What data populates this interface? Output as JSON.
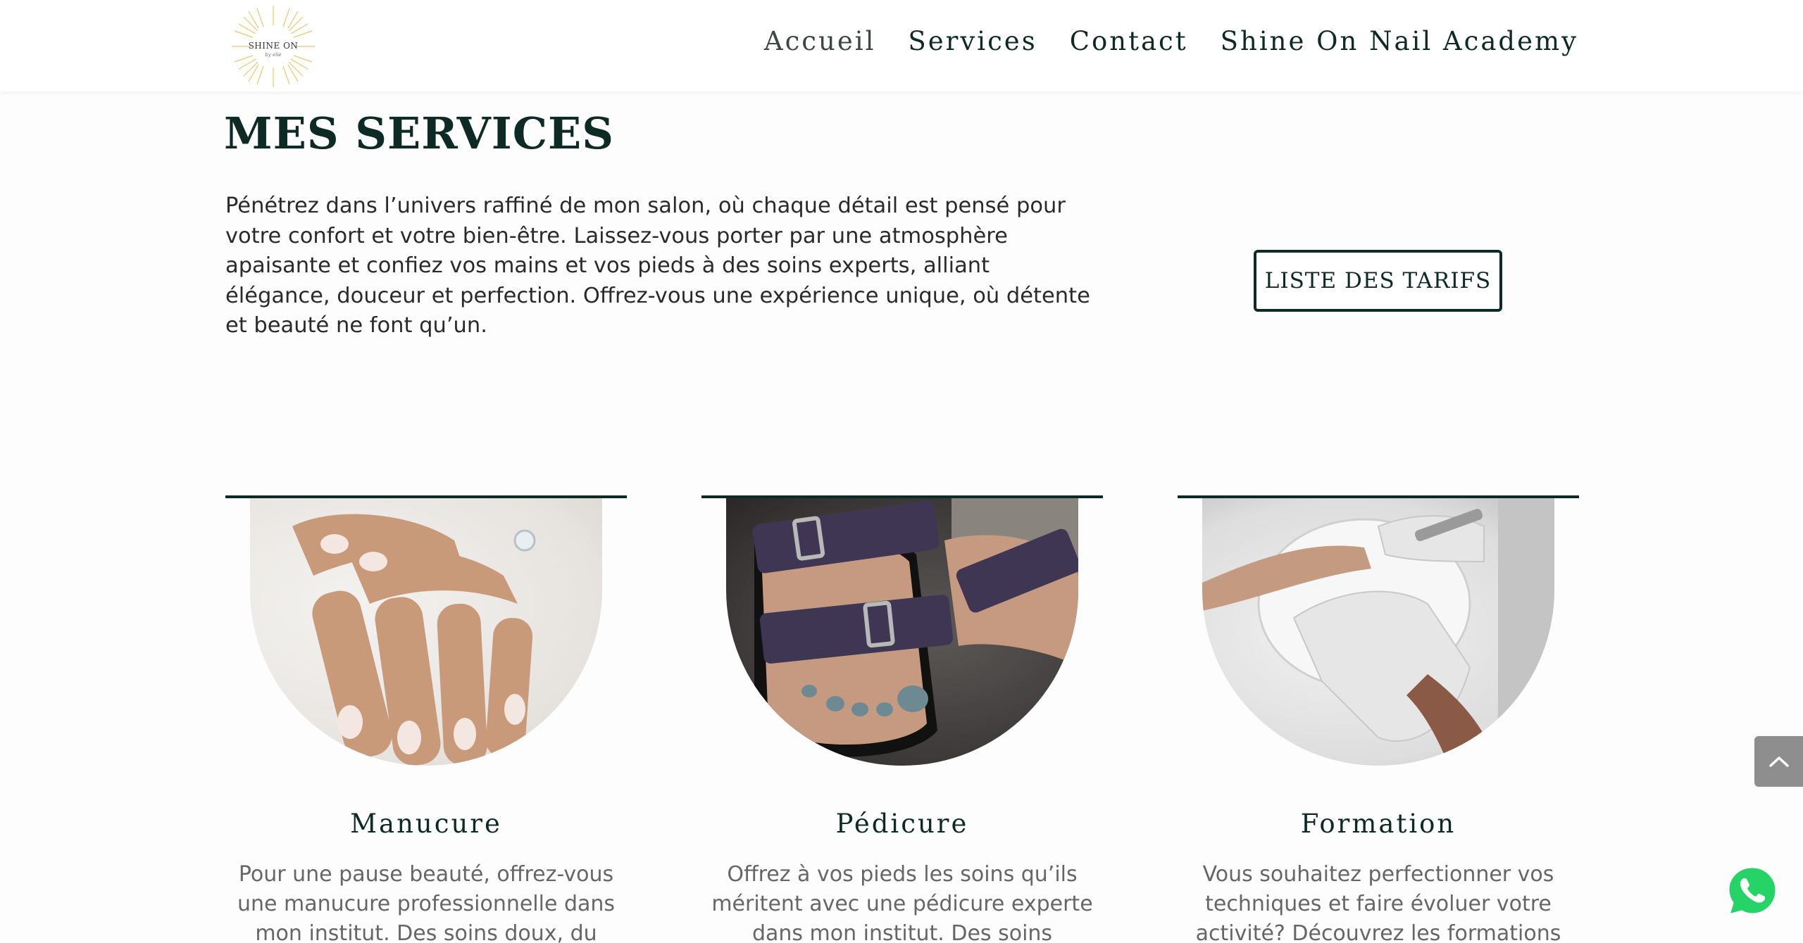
{
  "header": {
    "logo_text": "SHINE ON",
    "logo_sub": "by elie",
    "nav": [
      "Accueil",
      "Services",
      "Contact",
      "Shine On Nail Academy"
    ]
  },
  "intro": {
    "title": "MES SERVICES",
    "text": "Pénétrez dans l’univers raffiné de mon salon, où chaque détail est pensé pour votre confort et votre bien-être. Laissez-vous porter par une atmosphère apaisante et confiez vos mains et vos pieds à des soins experts, alliant élégance, douceur et perfection. Offrez-vous une expérience unique, où détente et beauté ne font qu’un.",
    "button": "LISTE DES TARIFS"
  },
  "services": [
    {
      "title": "Manucure",
      "text": "Pour une pause beauté, offrez-vous une manucure professionnelle dans mon institut. Des soins doux, du vernis"
    },
    {
      "title": "Pédicure",
      "text": "Offrez à vos pieds les soins qu’ils méritent avec une pédicure experte dans mon institut. Des soins adaptés,"
    },
    {
      "title": "Formation",
      "text": "Vous souhaitez perfectionner vos techniques et faire évoluer votre activité? Découvrez les formations que"
    }
  ],
  "colors": {
    "brand_dark": "#0d2a25",
    "logo_gold": "#e8c86a",
    "whatsapp_green": "#25d366",
    "scroll_button": "#8e8e8e"
  },
  "icons": {
    "logo": "sun-logo-icon",
    "scroll_top": "chevron-up-icon",
    "whatsapp": "whatsapp-icon"
  }
}
